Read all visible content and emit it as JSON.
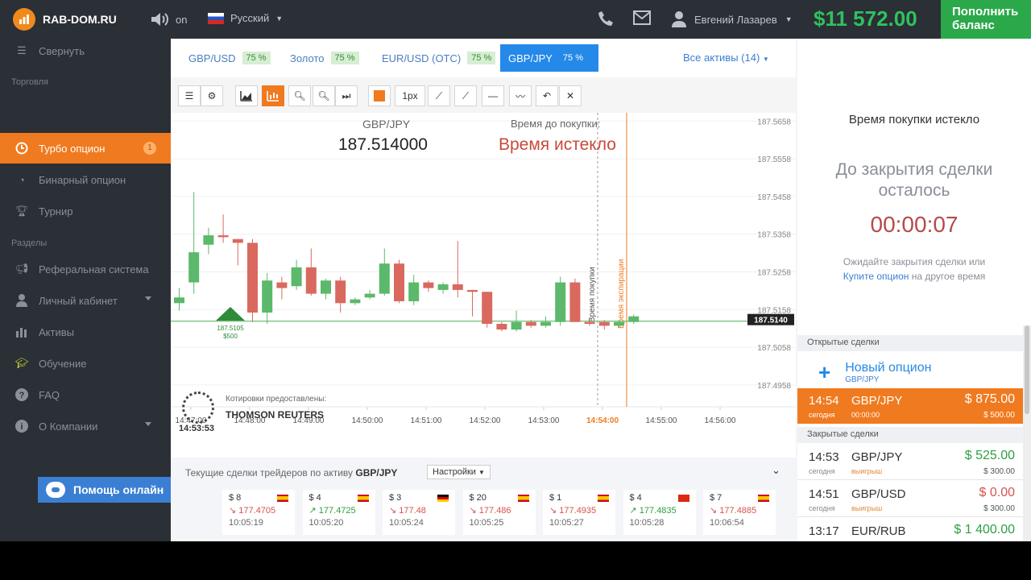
{
  "header": {
    "site": "RAB-DOM.RU",
    "sound": "on",
    "language": "Русский",
    "user": "Евгений Лазарев",
    "balance": "$11 572.00",
    "deposit_line1": "Пополнить",
    "deposit_line2": "баланс"
  },
  "sidebar": {
    "collapse": "Свернуть",
    "section_trading": "Торговля",
    "turbo": "Турбо опцион",
    "turbo_badge": "1",
    "binary": "Бинарный опцион",
    "tournament": "Турнир",
    "section_sections": "Разделы",
    "referral": "Реферальная система",
    "cabinet": "Личный кабинет",
    "assets": "Активы",
    "education": "Обучение",
    "faq": "FAQ",
    "about": "О Компании",
    "help": "Помощь онлайн"
  },
  "tabs": [
    {
      "label": "GBP/USD",
      "pct": "75 %"
    },
    {
      "label": "Золото",
      "pct": "75 %"
    },
    {
      "label": "EUR/USD (OTC)",
      "pct": "75 %"
    },
    {
      "label": "GBP/JPY",
      "pct": "75 %"
    }
  ],
  "all_assets": "Все активы (14)",
  "toolbar": {
    "px": "1px"
  },
  "chart_data": {
    "type": "candlestick",
    "asset": "GBP/JPY",
    "price": "187.514000",
    "purchase_label": "Время до покупки:",
    "purchase_status": "Время истекло",
    "y_ticks": [
      "187.5658",
      "187.5558",
      "187.5458",
      "187.5358",
      "187.5258",
      "187.5158",
      "187.5058",
      "187.4958"
    ],
    "y_range": [
      187.49,
      187.568
    ],
    "x_ticks": [
      "14:47:00",
      "14:48:00",
      "14:49:00",
      "14:50:00",
      "14:51:00",
      "14:52:00",
      "14:53:00",
      "14:54:00",
      "14:55:00",
      "14:56:00"
    ],
    "current_label": "187.5140",
    "current_value": 187.514,
    "entry_price": "187.5105",
    "entry_amount": "$500",
    "line_purchase": "Время покупки",
    "line_expiry": "Время экспирации",
    "candles": [
      {
        "o": 187.5175,
        "h": 187.5215,
        "l": 187.5155,
        "c": 187.519
      },
      {
        "o": 187.523,
        "h": 187.547,
        "l": 187.52,
        "c": 187.531
      },
      {
        "o": 187.533,
        "h": 187.5375,
        "l": 187.5305,
        "c": 187.5355
      },
      {
        "o": 187.5355,
        "h": 187.541,
        "l": 187.5335,
        "c": 187.535
      },
      {
        "o": 187.5345,
        "h": 187.5335,
        "l": 187.5275,
        "c": 187.5335
      },
      {
        "o": 187.5335,
        "h": 187.5345,
        "l": 187.5125,
        "c": 187.515
      },
      {
        "o": 187.515,
        "h": 187.5255,
        "l": 187.512,
        "c": 187.5235
      },
      {
        "o": 187.523,
        "h": 187.5245,
        "l": 187.5185,
        "c": 187.5215
      },
      {
        "o": 187.522,
        "h": 187.529,
        "l": 187.521,
        "c": 187.527
      },
      {
        "o": 187.527,
        "h": 187.532,
        "l": 187.5195,
        "c": 187.52
      },
      {
        "o": 187.52,
        "h": 187.524,
        "l": 187.5185,
        "c": 187.5235
      },
      {
        "o": 187.5235,
        "h": 187.5245,
        "l": 187.515,
        "c": 187.5175
      },
      {
        "o": 187.5175,
        "h": 187.519,
        "l": 187.517,
        "c": 187.5185
      },
      {
        "o": 187.519,
        "h": 187.521,
        "l": 187.5185,
        "c": 187.52
      },
      {
        "o": 187.52,
        "h": 187.532,
        "l": 187.5195,
        "c": 187.528
      },
      {
        "o": 187.528,
        "h": 187.529,
        "l": 187.5175,
        "c": 187.518
      },
      {
        "o": 187.518,
        "h": 187.525,
        "l": 187.517,
        "c": 187.523
      },
      {
        "o": 187.523,
        "h": 187.5235,
        "l": 187.5205,
        "c": 187.5215
      },
      {
        "o": 187.521,
        "h": 187.523,
        "l": 187.52,
        "c": 187.5225
      },
      {
        "o": 187.5225,
        "h": 187.534,
        "l": 187.519,
        "c": 187.521
      },
      {
        "o": 187.521,
        "h": 187.521,
        "l": 187.514,
        "c": 187.5205
      },
      {
        "o": 187.5205,
        "h": 187.5205,
        "l": 187.511,
        "c": 187.512
      },
      {
        "o": 187.512,
        "h": 187.5125,
        "l": 187.51,
        "c": 187.5105
      },
      {
        "o": 187.5105,
        "h": 187.5155,
        "l": 187.51,
        "c": 187.5125
      },
      {
        "o": 187.5125,
        "h": 187.513,
        "l": 187.511,
        "c": 187.5115
      },
      {
        "o": 187.5115,
        "h": 187.514,
        "l": 187.511,
        "c": 187.5125
      },
      {
        "o": 187.5125,
        "h": 187.5245,
        "l": 187.5115,
        "c": 187.523
      },
      {
        "o": 187.523,
        "h": 187.524,
        "l": 187.5125,
        "c": 187.5125
      },
      {
        "o": 187.5125,
        "h": 187.5135,
        "l": 187.5115,
        "c": 187.512
      },
      {
        "o": 187.5125,
        "h": 187.513,
        "l": 187.5105,
        "c": 187.5115
      },
      {
        "o": 187.5115,
        "h": 187.513,
        "l": 187.511,
        "c": 187.5125
      },
      {
        "o": 187.5125,
        "h": 187.5145,
        "l": 187.512,
        "c": 187.514
      }
    ],
    "provider_label": "Котировки предоставлены:",
    "provider": "THOMSON REUTERS",
    "clock": "14:53:53"
  },
  "trades": {
    "head": "Текущие сделки трейдеров по активу",
    "asset": "GBP/JPY",
    "settings": "Настройки",
    "cards": [
      {
        "amt": "$ 8",
        "rate": "177.4705",
        "dir": "down",
        "time": "10:05:19",
        "flag": "es"
      },
      {
        "amt": "$ 4",
        "rate": "177.4725",
        "dir": "up",
        "time": "10:05:20",
        "flag": "es"
      },
      {
        "amt": "$ 3",
        "rate": "177.48",
        "dir": "down",
        "time": "10:05:24",
        "flag": "de"
      },
      {
        "amt": "$ 20",
        "rate": "177.486",
        "dir": "down",
        "time": "10:05:25",
        "flag": "es"
      },
      {
        "amt": "$ 1",
        "rate": "177.4935",
        "dir": "down",
        "time": "10:05:27",
        "flag": "es"
      },
      {
        "amt": "$ 4",
        "rate": "177.4835",
        "dir": "up",
        "time": "10:05:28",
        "flag": "cn"
      },
      {
        "amt": "$ 7",
        "rate": "177.4885",
        "dir": "down",
        "time": "10:06:54",
        "flag": "es"
      }
    ]
  },
  "right": {
    "status": "Время покупки истекло",
    "remaining_line1": "До закрытия сделки",
    "remaining_line2": "осталось",
    "timer": "00:00:07",
    "wait_line1": "Ожидайте закрытия сделки или",
    "wait_link": "Купите опцион",
    "wait_line2": "на другое время",
    "open_deals": "Открытые сделки",
    "new_option": "Новый опцион",
    "new_option_sub": "GBP/JPY",
    "open": {
      "time": "14:54",
      "sub": "сегодня",
      "pair": "GBP/JPY",
      "pair_sub": "00:00:00",
      "amount": "$ 875.00",
      "inv": "$ 500.00"
    },
    "closed_deals": "Закрытые сделки",
    "closed": [
      {
        "time": "14:53",
        "sub": "сегодня",
        "pair": "GBP/JPY",
        "pair_sub": "выигрыш",
        "amount": "$ 525.00",
        "inv": "$ 300.00",
        "res": "win"
      },
      {
        "time": "14:51",
        "sub": "сегодня",
        "pair": "GBP/USD",
        "pair_sub": "выигрыш",
        "amount": "$ 0.00",
        "inv": "$ 300.00",
        "res": "loss"
      },
      {
        "time": "13:17",
        "sub": "сегодня",
        "pair": "EUR/RUB",
        "pair_sub": "",
        "amount": "$ 1 400.00",
        "inv": "",
        "res": "win"
      }
    ]
  }
}
